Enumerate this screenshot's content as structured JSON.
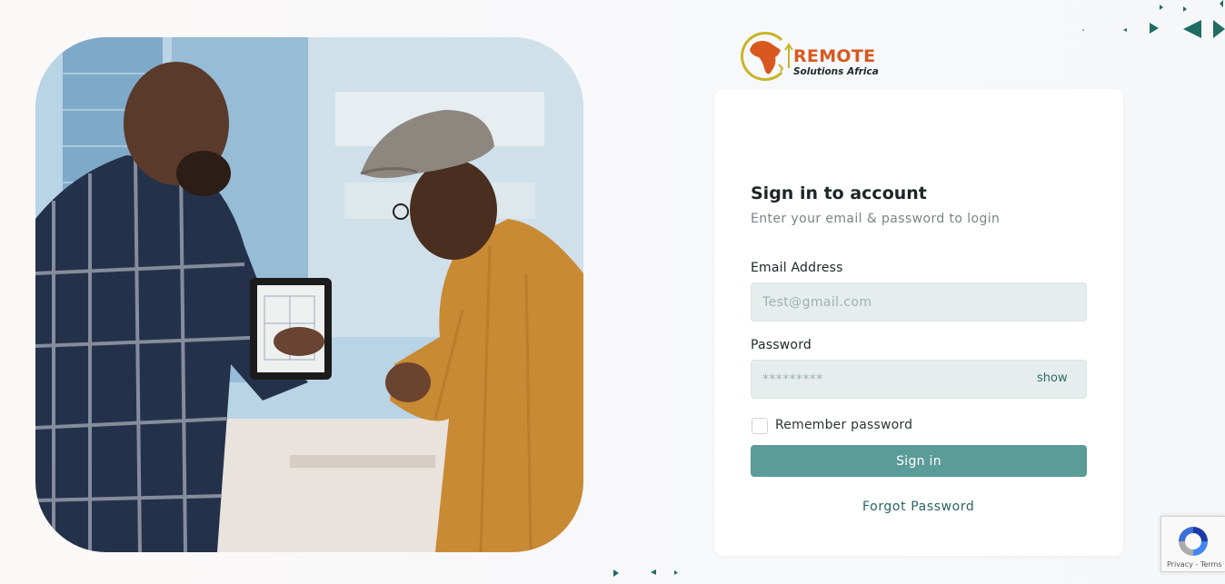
{
  "brand": {
    "word": "REMOTE",
    "sub": "Solutions Africa",
    "accent_orange": "#d8581f",
    "accent_gold": "#c8b428"
  },
  "login": {
    "title": "Sign in to account",
    "subtitle": "Enter your email & password to login",
    "email_label": "Email Address",
    "email_placeholder": "Test@gmail.com",
    "email_value": "",
    "password_label": "Password",
    "password_placeholder": "*********",
    "password_value": "",
    "show_label": "show",
    "remember_label": "Remember password",
    "remember_checked": false,
    "submit_label": "Sign in",
    "forgot_label": "Forgot Password"
  },
  "recaptcha": {
    "links": "Privacy - Terms"
  },
  "colors": {
    "primary_button": "#5b9b98",
    "input_bg": "#e5eded",
    "link": "#2b6363",
    "decor_teal": "#1f6d63"
  },
  "icons": [
    "africa-logo-icon",
    "recaptcha-icon",
    "triangle-decor-icon"
  ]
}
